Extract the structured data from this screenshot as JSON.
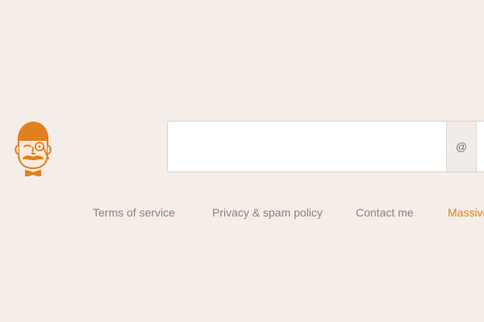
{
  "mascot": {
    "icon": "monocle-gentleman-icon",
    "accent_color": "#e1801f"
  },
  "signup": {
    "email_value": "",
    "email_placeholder": "",
    "at_symbol": "@"
  },
  "footer": {
    "links": [
      {
        "label": "Terms of service"
      },
      {
        "label": "Privacy & spam policy"
      },
      {
        "label": "Contact me"
      },
      {
        "label": "Massive",
        "color": "#e1801f"
      }
    ]
  }
}
